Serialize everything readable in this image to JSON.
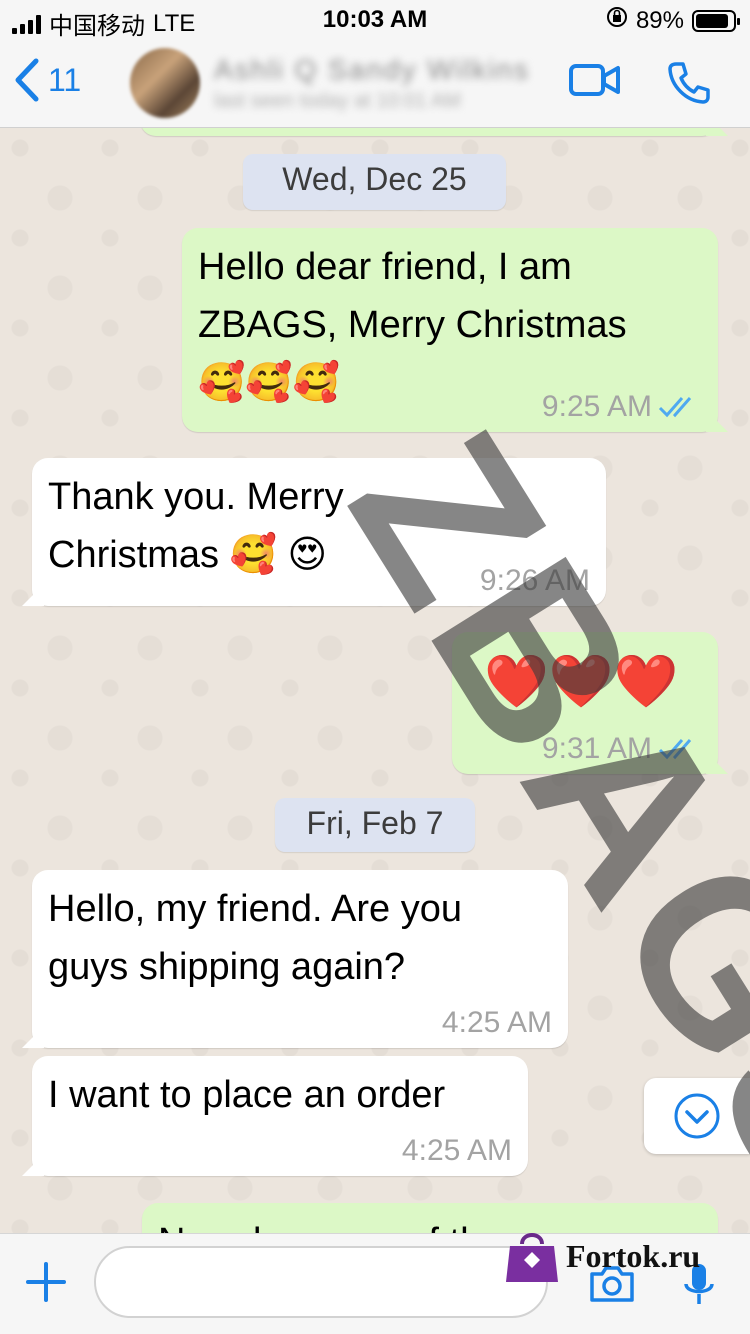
{
  "status": {
    "carrier": "中国移动",
    "network": "LTE",
    "time": "10:03 AM",
    "battery": "89%",
    "battery_level": 0.89
  },
  "header": {
    "back_count": "11",
    "contact_name": "Ashli Q Sandy Wilkins",
    "contact_subtitle": "last seen today at 10:01 AM"
  },
  "chat": {
    "date_1": "Wed, Dec 25",
    "msg1": {
      "line1": "Hello dear friend, I am",
      "line2": "ZBAGS, Merry Christmas",
      "line3": "🥰🥰🥰",
      "time": "9:25 AM"
    },
    "msg2": {
      "line1": "Thank you. Merry",
      "line2": "Christmas 🥰 😍",
      "time": "9:26 AM"
    },
    "msg3": {
      "text": "❤️❤️❤️",
      "time": "9:31 AM"
    },
    "date_2": "Fri, Feb 7",
    "msg4": {
      "line1": "Hello, my friend. Are you",
      "line2": "guys shipping again?",
      "time": "4:25 AM"
    },
    "msg5": {
      "text": "I want to place an order",
      "time": "4:25 AM"
    },
    "msg6": {
      "partial": "Now, because of the new"
    }
  },
  "watermark": "ZBAGS",
  "input": {
    "placeholder": ""
  },
  "brand": "Fortok.ru",
  "colors": {
    "accent": "#1a80e6",
    "outgoing": "#dcf8c6",
    "incoming": "#ffffff",
    "ticks": "#4fa9f0"
  }
}
